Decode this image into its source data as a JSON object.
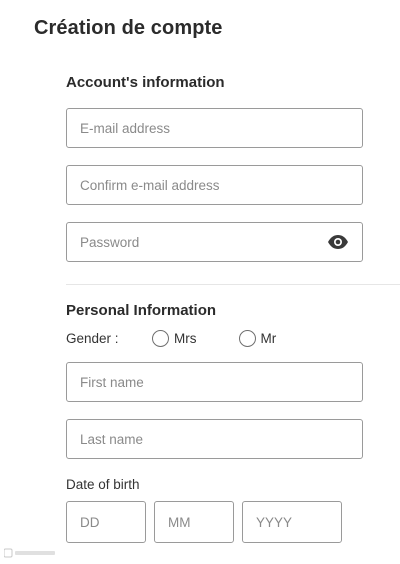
{
  "page": {
    "title": "Création de compte"
  },
  "account_section": {
    "title": "Account's information",
    "email_placeholder": "E-mail address",
    "confirm_email_placeholder": "Confirm e-mail address",
    "password_placeholder": "Password",
    "password_toggle_icon": "eye-icon"
  },
  "personal_section": {
    "title": "Personal Information",
    "gender_label": "Gender :",
    "gender_options": [
      "Mrs",
      "Mr"
    ],
    "first_name_placeholder": "First name",
    "last_name_placeholder": "Last name",
    "dob_label": "Date of birth",
    "dob_day_placeholder": "DD",
    "dob_month_placeholder": "MM",
    "dob_year_placeholder": "YYYY"
  },
  "colors": {
    "text": "#2b2b2b",
    "border": "#9a9a9a",
    "placeholder": "#8a8a8a",
    "divider": "#e6e6e6"
  }
}
